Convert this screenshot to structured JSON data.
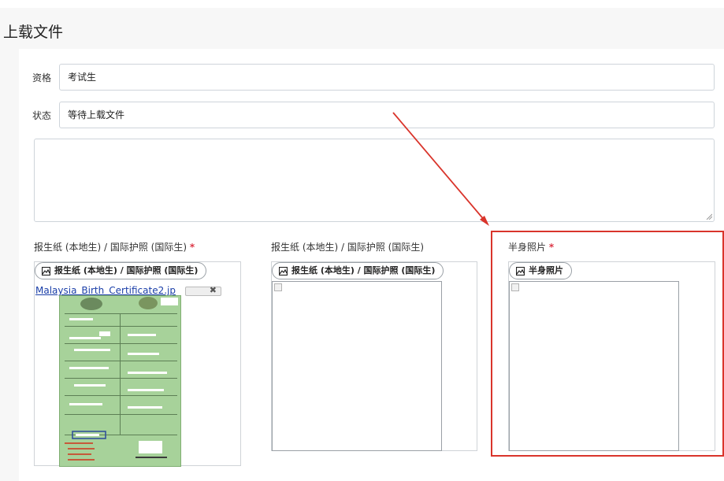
{
  "page": {
    "title": "上载文件"
  },
  "form": {
    "qualification": {
      "label": "资格",
      "value": "考试生"
    },
    "status": {
      "label": "状态",
      "value": "等待上载文件"
    },
    "remarks": {
      "value": ""
    }
  },
  "uploads": [
    {
      "label": "报生纸 (本地生) / 国际护照 (国际生)",
      "required": true,
      "button_label": "报生纸 (本地生) / 国际护照 (国际生)",
      "file_name": "Malaysia_Birth_Certificate2.jp",
      "remove_symbol": "✖"
    },
    {
      "label": "报生纸 (本地生) / 国际护照 (国际生)",
      "required": false,
      "button_label": "报生纸 (本地生) / 国际护照 (国际生)"
    },
    {
      "label": "半身照片",
      "required": true,
      "button_label": "半身照片"
    }
  ],
  "required_marker": "*",
  "colors": {
    "annotation": "#d9342b",
    "link": "#1a3ea8",
    "required": "#dc3545"
  },
  "icons": {
    "upload": "image-icon",
    "resize": "resize-grip-icon"
  }
}
